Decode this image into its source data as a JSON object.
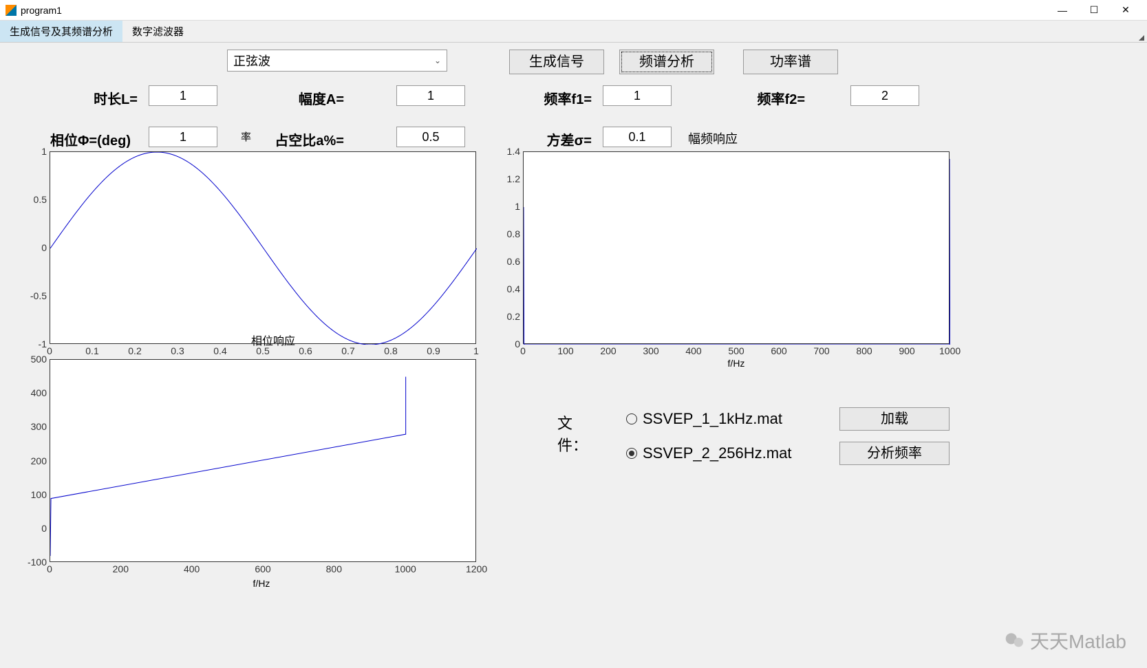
{
  "window": {
    "title": "program1"
  },
  "tabs": {
    "t0": "生成信号及其频谱分析",
    "t1": "数字滤波器"
  },
  "dropdown": {
    "selected": "正弦波"
  },
  "buttons": {
    "gen": "生成信号",
    "spec": "频谱分析",
    "power": "功率谱",
    "load": "加载",
    "analyze": "分析频率"
  },
  "params": {
    "len_label": "时长L=",
    "len_val": "1",
    "amp_label": "幅度A=",
    "amp_val": "1",
    "f1_label": "频率f1=",
    "f1_val": "1",
    "f2_label": "频率f2=",
    "f2_val": "2",
    "phase_label": "相位Φ=(deg)",
    "phase_val": "1",
    "duty_label": "占空比a%=",
    "duty_val": "0.5",
    "var_label": "方差σ=",
    "var_val": "0.1"
  },
  "overlap": {
    "phase_resp": "相位响应",
    "mag_resp": "幅频响应"
  },
  "files": {
    "label": "文件：",
    "opt1": "SSVEP_1_1kHz.mat",
    "opt2": "SSVEP_2_256Hz.mat"
  },
  "watermark": "天天Matlab",
  "chart_data": [
    {
      "type": "line",
      "title": "",
      "xlabel": "",
      "ylabel": "",
      "xlim": [
        0,
        1
      ],
      "ylim": [
        -1,
        1
      ],
      "xticks": [
        0,
        0.1,
        0.2,
        0.3,
        0.4,
        0.5,
        0.6,
        0.7,
        0.8,
        0.9,
        1
      ],
      "yticks": [
        -1,
        -0.5,
        0,
        0.5,
        1
      ],
      "series": [
        {
          "name": "sine",
          "fn": "sin(2*pi*x)",
          "x_range": [
            0,
            1
          ],
          "samples": 200
        }
      ]
    },
    {
      "type": "line",
      "title": "相位响应",
      "xlabel": "f/Hz",
      "ylabel": "",
      "xlim": [
        0,
        1200
      ],
      "ylim": [
        -100,
        500
      ],
      "xticks": [
        0,
        200,
        400,
        600,
        800,
        1000,
        1200
      ],
      "yticks": [
        -100,
        0,
        100,
        200,
        300,
        400,
        500
      ],
      "series": [
        {
          "name": "phase",
          "points": [
            [
              0,
              -80
            ],
            [
              2,
              90
            ],
            [
              1000,
              280
            ],
            [
              1000,
              450
            ]
          ]
        }
      ]
    },
    {
      "type": "line",
      "title": "幅频响应",
      "xlabel": "f/Hz",
      "ylabel": "",
      "xlim": [
        0,
        1000
      ],
      "ylim": [
        0,
        1.4
      ],
      "xticks": [
        0,
        100,
        200,
        300,
        400,
        500,
        600,
        700,
        800,
        900,
        1000
      ],
      "yticks": [
        0,
        0.2,
        0.4,
        0.6,
        0.8,
        1,
        1.2,
        1.4
      ],
      "series": [
        {
          "name": "mag",
          "points": [
            [
              0,
              1
            ],
            [
              1,
              0
            ],
            [
              999,
              0
            ],
            [
              1000,
              1.35
            ]
          ]
        }
      ]
    }
  ]
}
